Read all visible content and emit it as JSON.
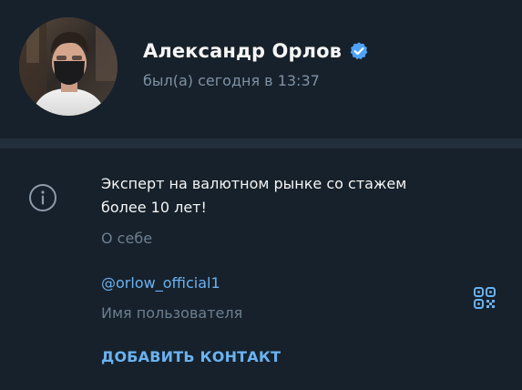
{
  "profile": {
    "name": "Александр Орлов",
    "status": "был(а) сегодня в 13:37",
    "verified": true
  },
  "info": {
    "bio_lines": [
      "Эксперт на валютном рынке со стажем",
      "более 10 лет!"
    ],
    "bio_caption": "О себе",
    "username": "@orlow_official1",
    "username_caption": "Имя пользователя",
    "add_contact_label": "ДОБАВИТЬ КОНТАКТ"
  },
  "icons": {
    "verified": "verified-badge-icon",
    "info": "info-icon",
    "qr": "qr-code-icon"
  },
  "colors": {
    "background": "#17212b",
    "band": "#232e3c",
    "primary_text": "#f5f5f5",
    "secondary_text": "#7f91a4",
    "accent": "#6ab2f2",
    "verified": "#4fa3f7"
  }
}
